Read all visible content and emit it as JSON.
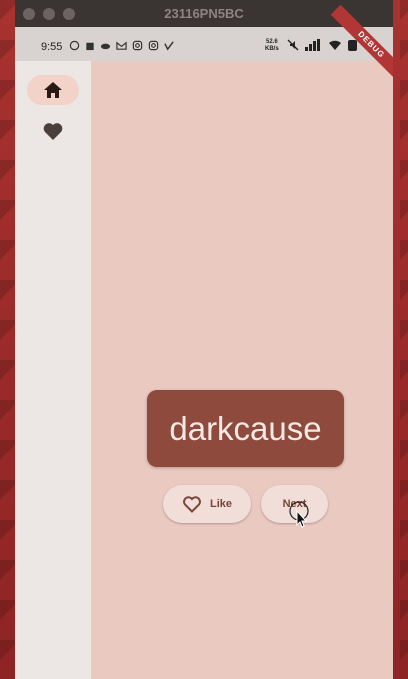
{
  "window": {
    "title": "23116PN5BC"
  },
  "status_bar": {
    "time": "9:55",
    "speed_value": "52.6",
    "speed_unit": "KB/s"
  },
  "debug_banner": "DEBUG",
  "rail": {
    "items": [
      {
        "name": "home",
        "icon": "home-icon",
        "selected": true
      },
      {
        "name": "favorites",
        "icon": "heart-icon",
        "selected": false
      }
    ]
  },
  "main": {
    "word": "darkcause",
    "like_label": "Like",
    "next_label": "Next"
  },
  "colors": {
    "background": "#eac9c0",
    "rail": "#ece6e4",
    "card": "#8e4a3c",
    "button": "#f1ded8",
    "accent_text": "#7a4538"
  }
}
